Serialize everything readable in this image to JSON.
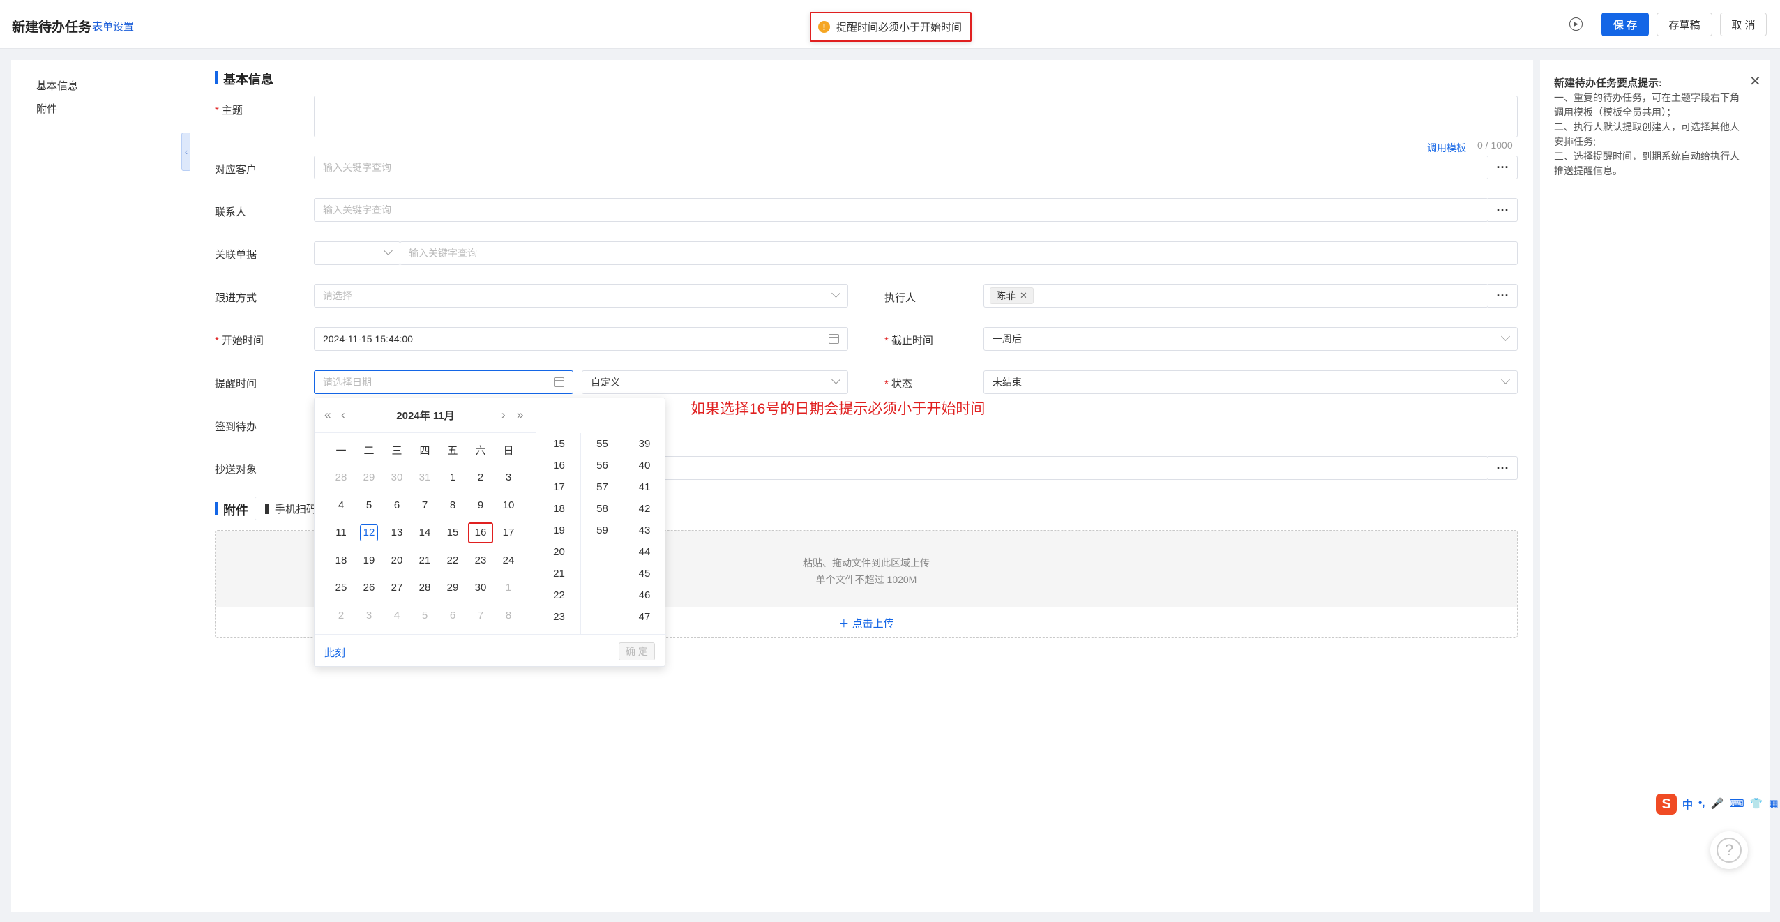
{
  "header": {
    "title": "新建待办任务",
    "form_settings": "表单设置",
    "toast": "提醒时间必须小于开始时间",
    "save": "保 存",
    "draft": "存草稿",
    "cancel": "取 消"
  },
  "sidebar": {
    "items": [
      {
        "label": "基本信息"
      },
      {
        "label": "附件"
      }
    ]
  },
  "form": {
    "section_basic": "基本信息",
    "subject_label": "主题",
    "template_link": "调用模板",
    "char_count": "0 / 1000",
    "customer_label": "对应客户",
    "customer_placeholder": "输入关键字查询",
    "contact_label": "联系人",
    "contact_placeholder": "输入关键字查询",
    "linked_doc_label": "关联单据",
    "linked_doc_placeholder": "输入关键字查询",
    "follow_label": "跟进方式",
    "follow_placeholder": "请选择",
    "executor_label": "执行人",
    "executor_tag": "陈菲",
    "start_label": "开始时间",
    "start_value": "2024-11-15 15:44:00",
    "deadline_label": "截止时间",
    "deadline_value": "一周后",
    "remind_label": "提醒时间",
    "remind_placeholder": "请选择日期",
    "remind_mode": "自定义",
    "status_label": "状态",
    "status_value": "未结束",
    "checkin_label": "签到待办",
    "cc_label": "抄送对象",
    "section_attach": "附件",
    "qr_label": "手机扫码上传",
    "drop_line1": "粘贴、拖动文件到此区域上传",
    "drop_line2": "单个文件不超过 1020M",
    "upload_link": "点击上传"
  },
  "picker": {
    "header": "2024年  11月",
    "weekdays": [
      "一",
      "二",
      "三",
      "四",
      "五",
      "六",
      "日"
    ],
    "weeks": [
      [
        "28",
        "29",
        "30",
        "31",
        "1",
        "2",
        "3"
      ],
      [
        "4",
        "5",
        "6",
        "7",
        "8",
        "9",
        "10"
      ],
      [
        "11",
        "12",
        "13",
        "14",
        "15",
        "16",
        "17"
      ],
      [
        "18",
        "19",
        "20",
        "21",
        "22",
        "23",
        "24"
      ],
      [
        "25",
        "26",
        "27",
        "28",
        "29",
        "30",
        "1"
      ],
      [
        "2",
        "3",
        "4",
        "5",
        "6",
        "7",
        "8"
      ]
    ],
    "hours": [
      "15",
      "16",
      "17",
      "18",
      "19",
      "20",
      "21",
      "22",
      "23"
    ],
    "minutes": [
      "55",
      "56",
      "57",
      "58",
      "59"
    ],
    "seconds": [
      "39",
      "40",
      "41",
      "42",
      "43",
      "44",
      "45",
      "46",
      "47"
    ],
    "now": "此刻",
    "ok": "确 定",
    "today": "12",
    "highlight": "16"
  },
  "annotation": "如果选择16号的日期会提示必须小于开始时间",
  "tips": {
    "title": "新建待办任务要点提示:",
    "lines": [
      "一、重复的待办任务，可在主题字段右下角",
      "调用模板（模板全员共用）；",
      "二、执行人默认提取创建人，可选择其他人",
      "安排任务;",
      "三、选择提醒时间，到期系统自动给执行人",
      "推送提醒信息。"
    ]
  },
  "ime": {
    "s": "S",
    "items": [
      "中",
      "•,",
      "🎤",
      "⌨",
      "👕",
      "▦"
    ]
  },
  "help": "?",
  "colors": {
    "primary": "#1466e6",
    "error": "#e02020"
  }
}
